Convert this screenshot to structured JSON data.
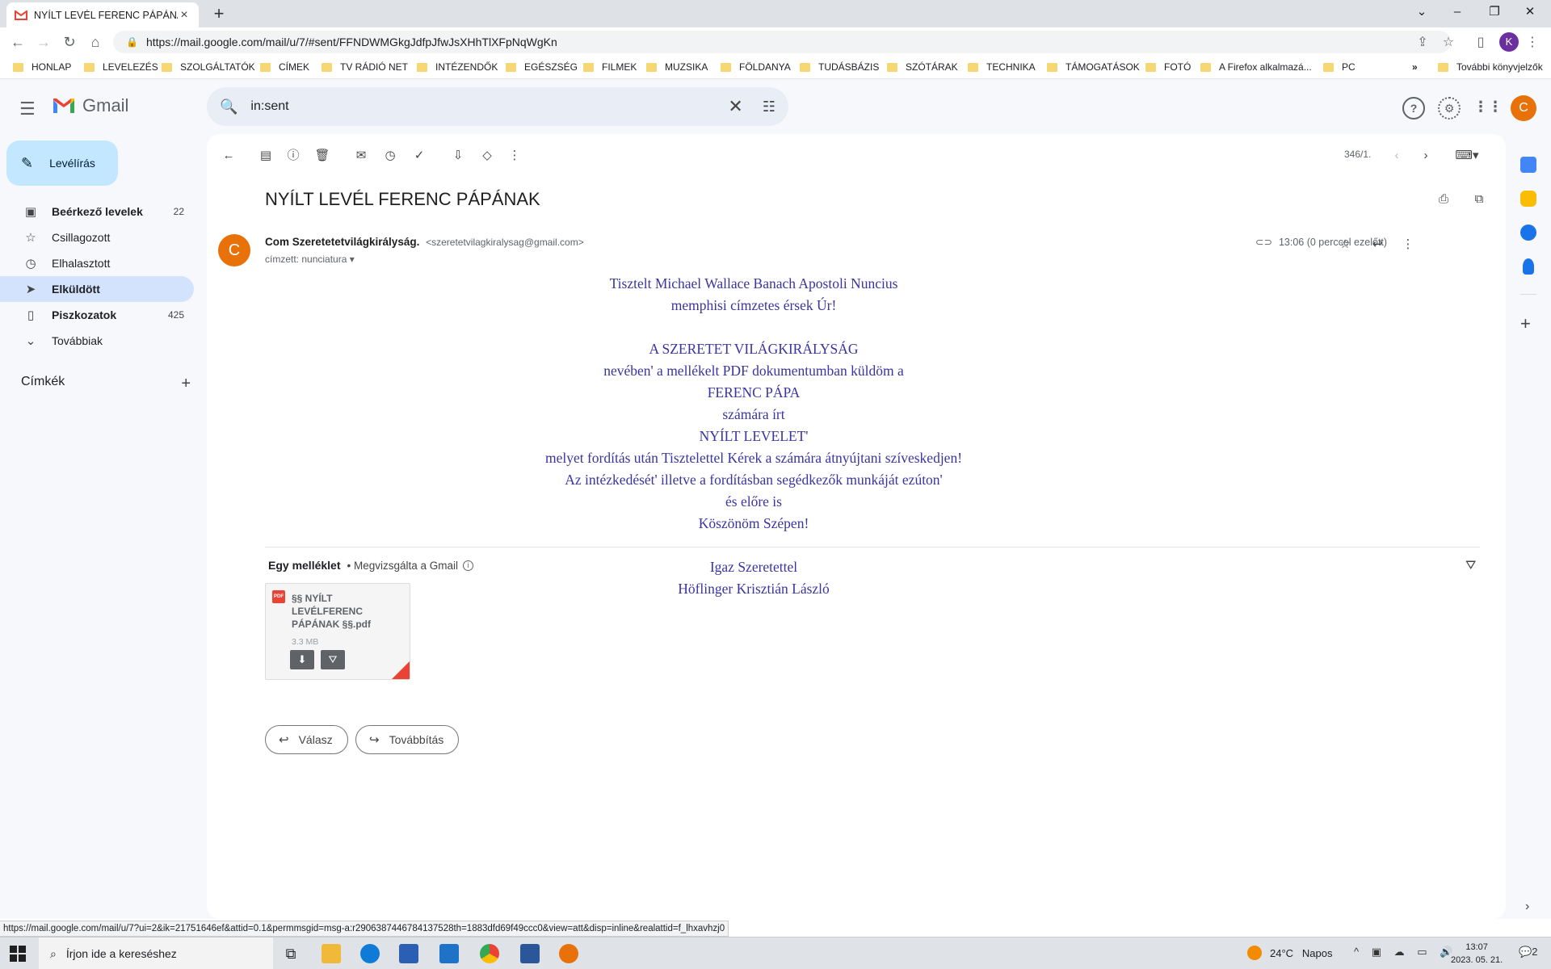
{
  "browser": {
    "tab_title": "NYÍLT LEVÉL FERENC PÁPÁNAK -",
    "url": "https://mail.google.com/mail/u/7/#sent/FFNDWMGkgJdfpJfwJsXHhTlXFpNqWgKn",
    "profile_initial": "K",
    "bookmarks": [
      "HONLAP",
      "LEVELEZÉS",
      "SZOLGÁLTATÓK",
      "CÍMEK",
      "TV RÁDIÓ NET",
      "INTÉZENDŐK",
      "EGÉSZSÉG",
      "FILMEK",
      "MUZSIKA",
      "FÖLDANYA",
      "TUDÁSBÁZIS",
      "SZÓTÁRAK",
      "TECHNIKA",
      "TÁMOGATÁSOK",
      "FOTÓ",
      "A Firefox alkalmazá...",
      "PC"
    ],
    "bookmarks_overflow": "»",
    "other_bookmarks": "További könyvjelzők",
    "status_url": "https://mail.google.com/mail/u/7?ui=2&ik=21751646ef&attid=0.1&permmsgid=msg-a:r2906387446784137528th=1883dfd69f49ccc0&view=att&disp=inline&realattid=f_lhxavhzj0"
  },
  "gmail": {
    "logo_text": "Gmail",
    "search_value": "in:sent",
    "account_initial": "C",
    "compose_label": "Levélírás",
    "nav": [
      {
        "label": "Beérkező levelek",
        "count": "22"
      },
      {
        "label": "Csillagozott",
        "count": ""
      },
      {
        "label": "Elhalasztott",
        "count": ""
      },
      {
        "label": "Elküldött",
        "count": ""
      },
      {
        "label": "Piszkozatok",
        "count": "425"
      },
      {
        "label": "Továbbiak",
        "count": ""
      }
    ],
    "labels_title": "Címkék",
    "counter": "346/1.",
    "message": {
      "subject": "NYÍLT LEVÉL FERENC PÁPÁNAK",
      "sender_initial": "C",
      "sender_name": "Com Szeretetetvilágkirályság.",
      "sender_email": "<szeretetvilagkiralysag@gmail.com>",
      "recipient": "címzett: nunciatura",
      "time": "13:06 (0 perccel ezelőtt)",
      "body": [
        "Tisztelt Michael Wallace Banach Apostoli Nuncius",
        "memphisi címzetes érsek Úr!",
        "",
        "A SZERETET VILÁGKIRÁLYSÁG",
        "nevében' a mellékelt PDF dokumentumban küldöm a",
        "FERENC PÁPA",
        "számára írt",
        "NYÍLT LEVELET'",
        "melyet fordítás után Tisztelettel Kérek a számára átnyújtani szíveskedjen!",
        "Az intézkedését' illetve a fordításban segédkezők munkáját ezúton'",
        "és előre is",
        "Köszönöm Szépen!",
        "",
        "Igaz Szeretettel",
        "Höflinger Krisztián László"
      ]
    },
    "attachments": {
      "title": "Egy melléklet",
      "scanned": "• Megvizsgálta a Gmail",
      "file_badge": "PDF",
      "file_name": "§§ NYÍLT LEVÉLFERENC PÁPÁNAK §§.pdf",
      "file_size": "3.3 MB"
    },
    "reply_label": "Válasz",
    "forward_label": "Továbbítás"
  },
  "taskbar": {
    "search_placeholder": "Írjon ide a kereséshez",
    "temperature": "24°C",
    "weather": "Napos",
    "time": "13:07",
    "date": "2023. 05. 21.",
    "notifications": "2"
  }
}
